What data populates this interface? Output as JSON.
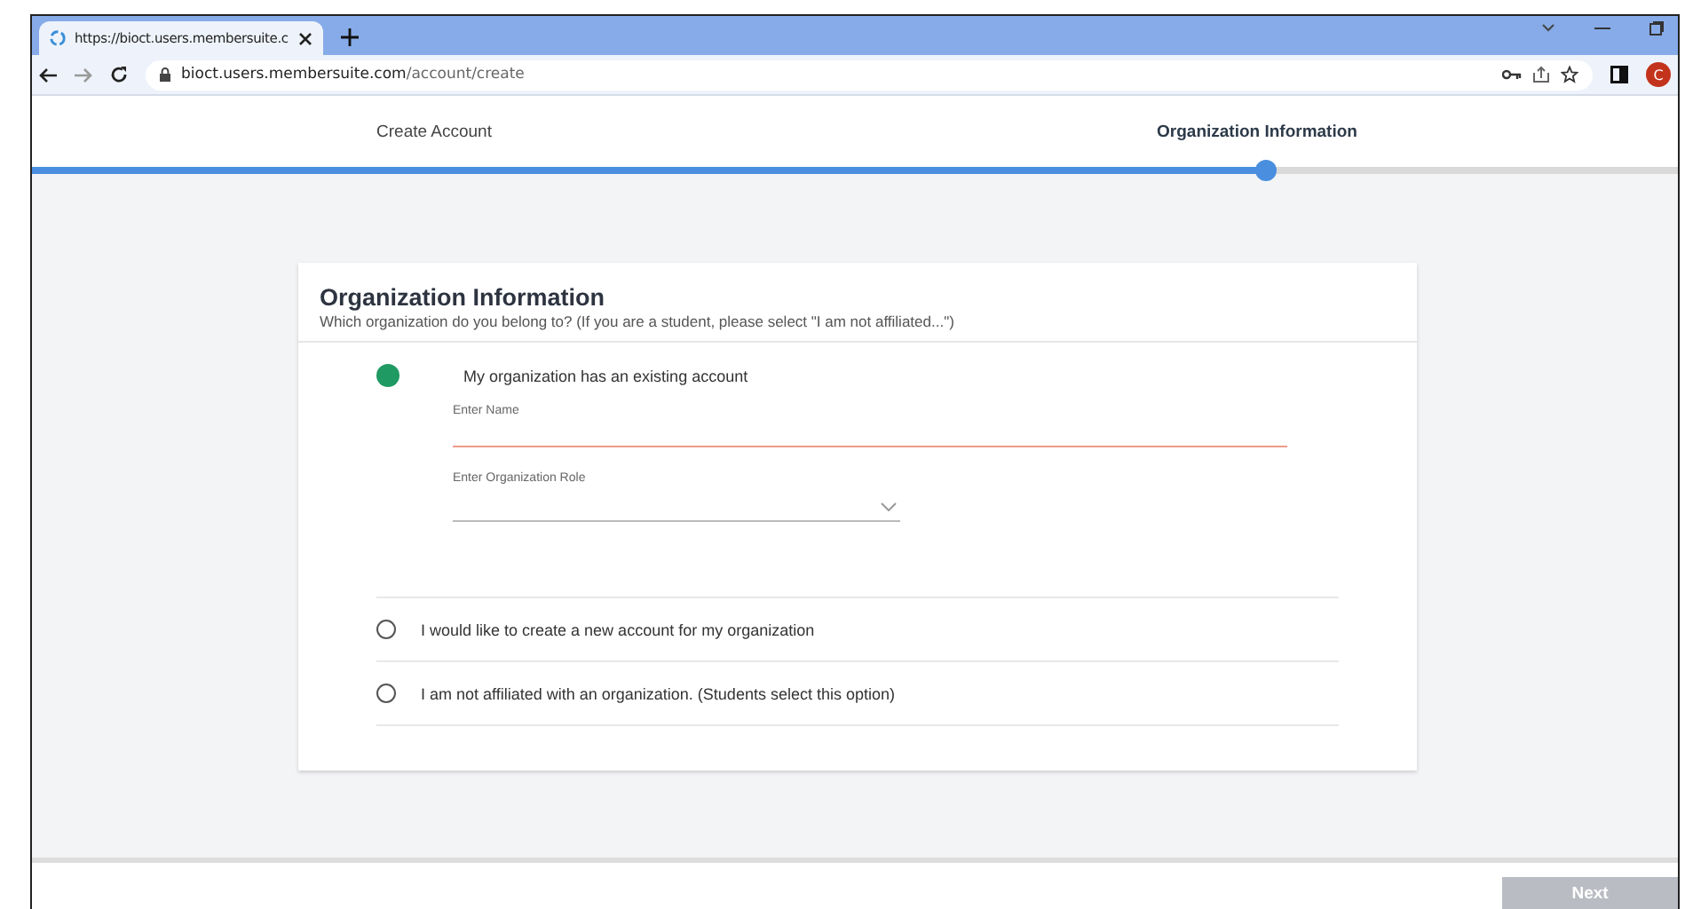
{
  "browser": {
    "tab_title": "https://bioct.users.membersuite.c",
    "url_host": "bioct.users.membersuite.com",
    "url_path": "/account/create",
    "profile_initial": "C"
  },
  "stepper": {
    "level": 0.75,
    "steps": [
      {
        "label": "Create Account",
        "selected": false
      },
      {
        "label": "Organization Information",
        "selected": true
      }
    ]
  },
  "card": {
    "title": "Organization Information",
    "subtitle": "Which organization do you belong to? (If you are a student, please select \"I am not affiliated...\")",
    "options": [
      {
        "label": "My organization has an existing account",
        "selected": true,
        "fields": [
          {
            "kind": "text",
            "placeholder": "Enter Name",
            "invalid": true
          },
          {
            "kind": "dropdown",
            "placeholder": "Enter Organization Role",
            "invalid": false
          }
        ]
      },
      {
        "label": "I would like to create a new account for my organization",
        "selected": false
      },
      {
        "label": "I am not affiliated with an organization. (Students select this option)",
        "selected": false
      }
    ]
  },
  "footer": {
    "next_button": {
      "label": "Next",
      "disabled": true
    }
  }
}
